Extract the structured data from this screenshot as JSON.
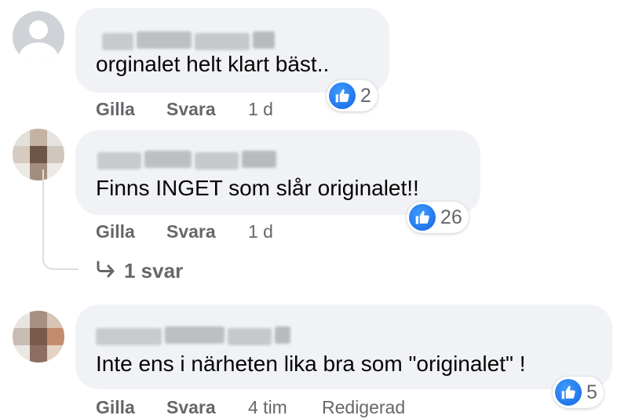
{
  "comments": [
    {
      "text": "orginalet helt klart bäst..",
      "reaction_count": "2",
      "actions": {
        "like": "Gilla",
        "reply": "Svara",
        "time": "1 d",
        "edited": ""
      }
    },
    {
      "text": "Finns INGET som slår originalet!!",
      "reaction_count": "26",
      "actions": {
        "like": "Gilla",
        "reply": "Svara",
        "time": "1 d",
        "edited": ""
      },
      "replies_link": "1 svar"
    },
    {
      "text": "Inte ens i närheten lika bra som \"originalet\" !",
      "reaction_count": "5",
      "actions": {
        "like": "Gilla",
        "reply": "Svara",
        "time": "4 tim",
        "edited": "Redigerad"
      }
    }
  ],
  "icons": {
    "like": "thumbs-up-icon",
    "reply_arrow": "reply-arrow-icon",
    "avatar_default": "default-avatar-icon"
  },
  "colors": {
    "bubble": "#f0f2f5",
    "like_blue": "#1877f2",
    "meta_text": "#65676b",
    "text": "#050505"
  }
}
